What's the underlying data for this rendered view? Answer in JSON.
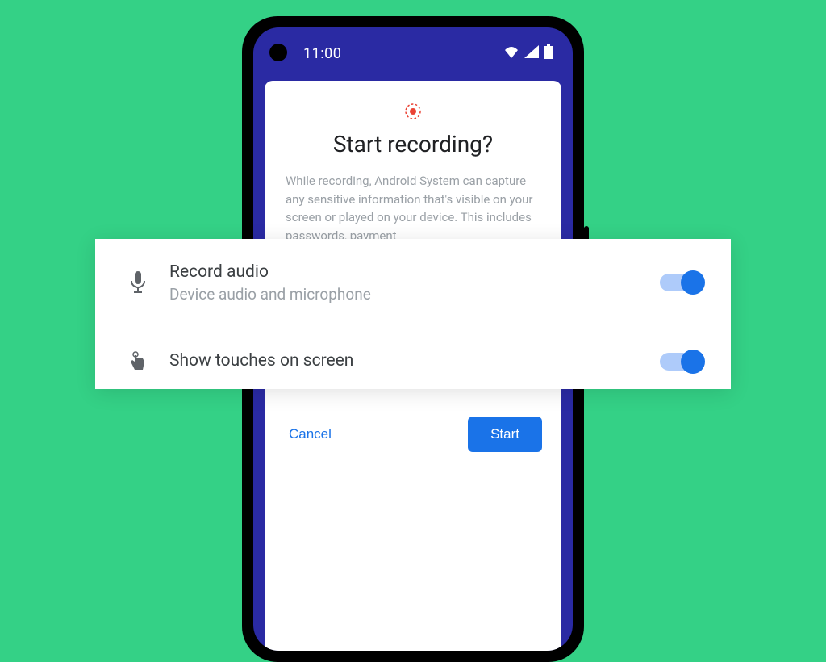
{
  "status": {
    "time": "11:00"
  },
  "dialog": {
    "title": "Start recording?",
    "body": "While recording, Android System can capture any sensitive information that's visible on your screen or played on your device. This includes passwords, payment",
    "cancel": "Cancel",
    "start": "Start"
  },
  "options": {
    "audio": {
      "title": "Record audio",
      "sub": "Device audio and microphone",
      "enabled": true
    },
    "touches": {
      "title": "Show touches on screen",
      "enabled": true
    }
  },
  "colors": {
    "bg": "#34d186",
    "accent": "#1a73e8",
    "phone_bg": "#2a2aa3"
  }
}
